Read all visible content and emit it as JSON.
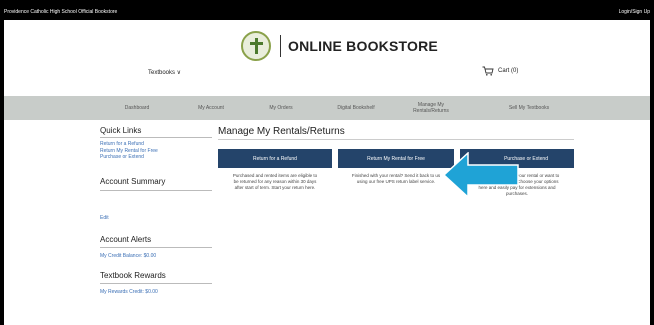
{
  "topbar": {
    "left": "Providence Catholic High School Official Bookstore",
    "right": "Login/Sign Up"
  },
  "logo": {
    "text": "ONLINE BOOKSTORE",
    "seal_icon": "school-seal-icon"
  },
  "header": {
    "textbooks": "Textbooks ∨",
    "cart": "Cart (0)"
  },
  "nav": [
    "Dashboard",
    "My Account",
    "My Orders",
    "Digital Bookshelf",
    "Manage My\nRentals/Returns",
    "Sell My Textbooks"
  ],
  "sidebar": {
    "quick_links_title": "Quick Links",
    "quick_links": [
      "Return for a Refund",
      "Return My Rental for Free",
      "Purchase or Extend"
    ],
    "account_summary_title": "Account Summary",
    "edit": "Edit",
    "alerts_title": "Account Alerts",
    "credit_balance": "My Credit Balance: $0.00",
    "rewards_title": "Textbook Rewards",
    "rewards_credit": "My Rewards Credit: $0.00"
  },
  "main": {
    "title": "Manage My Rentals/Returns",
    "buttons": [
      "Return for a Refund",
      "Return My Rental for Free",
      "Purchase or Extend"
    ],
    "descriptions": [
      "Purchased and rented items are eligible to\nbe returned for any reason within 30 days\nafter start of term. Start your return here.",
      "Finished with your rental? Send it back to us\nusing our free UPS return label service.",
      "Need extra time with your rental or want to\npurchase it to keep? Choose your options\nhere and easily pay for extensions and\npurchases."
    ]
  },
  "colors": {
    "accent_button": "#24446a",
    "pointer_arrow": "#1fa3d6",
    "nav_bg": "#c8ccc9",
    "link": "#3b6fb5"
  }
}
